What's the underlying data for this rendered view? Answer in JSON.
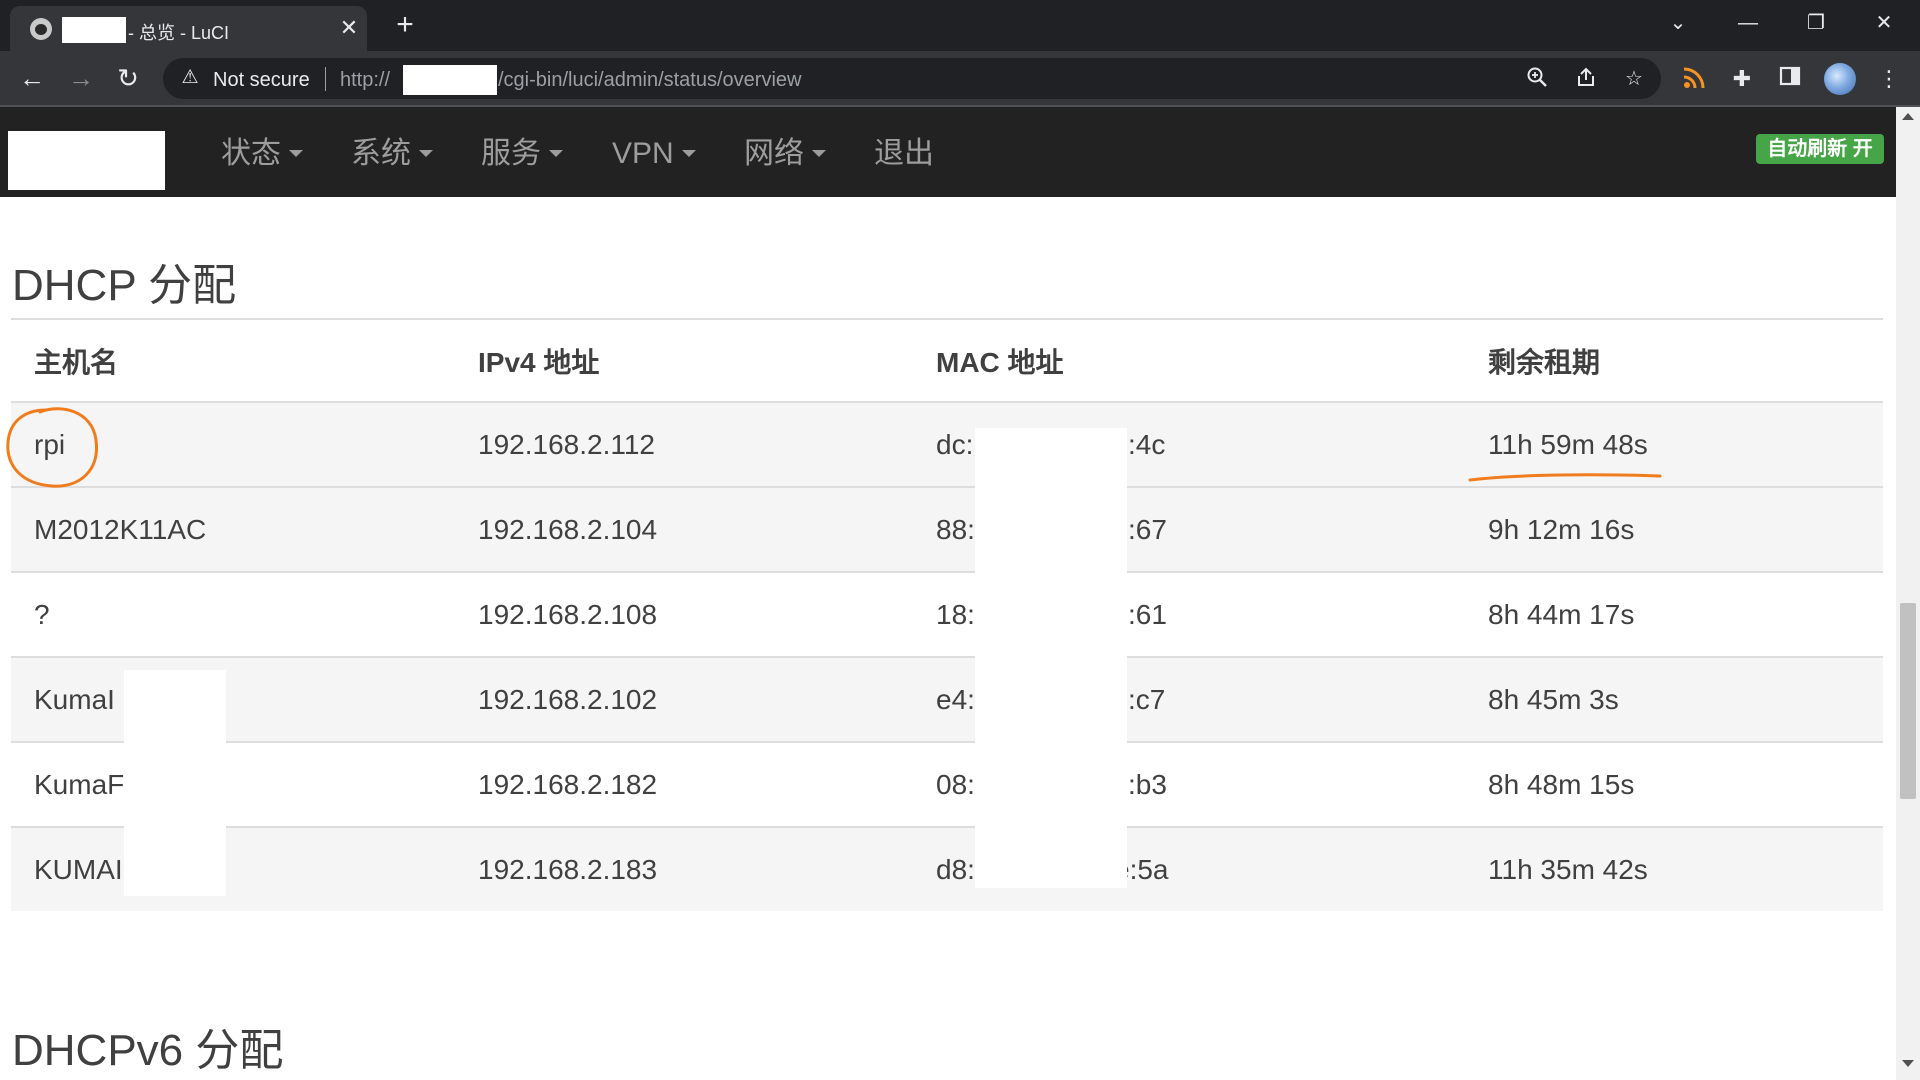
{
  "browser": {
    "tab_title": "- 总览 - LuCI",
    "tab_close": "✕",
    "new_tab": "+",
    "window_controls": {
      "tab_search": "⌄",
      "minimize": "—",
      "restore": "❐",
      "close": "✕"
    },
    "nav": {
      "back": "←",
      "forward": "→",
      "reload": "↻"
    },
    "security_label": "Not secure",
    "url_prefix": "http://",
    "url_suffix": "/cgi-bin/luci/admin/status/overview",
    "icons": [
      "zoom-icon",
      "share-icon",
      "star-icon",
      "rss-icon",
      "extensions-icon",
      "sidepanel-icon",
      "profile-avatar",
      "menu-icon"
    ]
  },
  "luci": {
    "menu": [
      {
        "label": "状态",
        "dropdown": true
      },
      {
        "label": "系统",
        "dropdown": true
      },
      {
        "label": "服务",
        "dropdown": true
      },
      {
        "label": "VPN",
        "dropdown": true
      },
      {
        "label": "网络",
        "dropdown": true
      },
      {
        "label": "退出",
        "dropdown": false
      }
    ],
    "autorefresh_label": "自动刷新 开",
    "accent_color": "#46a546",
    "header_bg": "#222222"
  },
  "dhcp": {
    "title": "DHCP 分配",
    "columns": [
      "主机名",
      "IPv4 地址",
      "MAC 地址",
      "剩余租期"
    ],
    "rows": [
      {
        "hostname": "rpi",
        "ipv4": "192.168.2.112",
        "mac_start": "dc:",
        "mac_end": ":4c",
        "lease": "11h 59m 48s"
      },
      {
        "hostname": "M2012K11AC",
        "ipv4": "192.168.2.104",
        "mac_start": "88:",
        "mac_end": ":67",
        "lease": "9h 12m 16s"
      },
      {
        "hostname": "?",
        "ipv4": "192.168.2.108",
        "mac_start": "18:",
        "mac_end": ":61",
        "lease": "8h 44m 17s"
      },
      {
        "hostname": "KumaI",
        "ipv4": "192.168.2.102",
        "mac_start": "e4:",
        "mac_end": ":c7",
        "lease": "8h 45m 3s"
      },
      {
        "hostname": "KumaF",
        "ipv4": "192.168.2.182",
        "mac_start": "08:",
        "mac_end": ":b3",
        "lease": "8h 48m 15s"
      },
      {
        "hostname": "KUMAI",
        "ipv4": "192.168.2.183",
        "mac_start": "d8:",
        "mac_end": "e:5a",
        "lease": "11h 35m 42s"
      }
    ]
  },
  "dhcpv6": {
    "title": "DHCPv6 分配"
  },
  "annotation_color": "#f07c1e"
}
